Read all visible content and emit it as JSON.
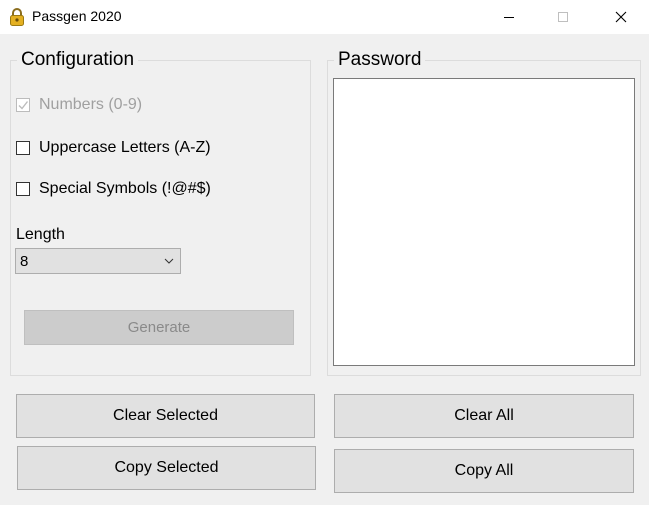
{
  "window": {
    "title": "Passgen 2020",
    "icon": "padlock-icon"
  },
  "config": {
    "legend": "Configuration",
    "options": [
      {
        "label": "Numbers (0-9)",
        "checked": true,
        "enabled": false
      },
      {
        "label": "Uppercase Letters (A-Z)",
        "checked": false,
        "enabled": true
      },
      {
        "label": "Special Symbols (!@#$)",
        "checked": false,
        "enabled": true
      }
    ],
    "length_label": "Length",
    "length_value": "8",
    "generate_label": "Generate"
  },
  "password": {
    "legend": "Password",
    "value": ""
  },
  "buttons": {
    "clear_selected": "Clear Selected",
    "clear_all": "Clear All",
    "copy_selected": "Copy Selected",
    "copy_all": "Copy All"
  },
  "colors": {
    "background": "#f0f0f0",
    "button_face": "#e1e1e1",
    "disabled_text": "#a0a0a0"
  }
}
